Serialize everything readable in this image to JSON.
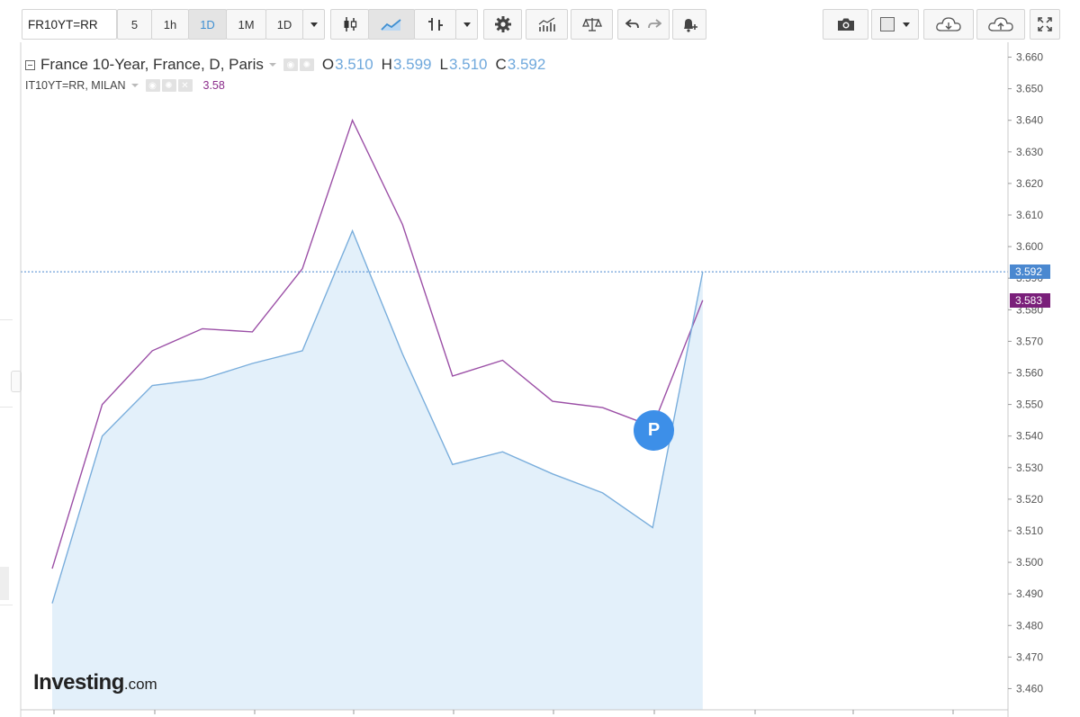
{
  "toolbar": {
    "symbol": "FR10YT=RR",
    "intervals": [
      "5",
      "1h",
      "1D",
      "1M",
      "1D"
    ],
    "active_interval_index": 2,
    "icons": [
      "candlestick-icon",
      "area-chart-icon",
      "bar-style-icon",
      "settings-gear-icon",
      "indicators-icon",
      "compare-scale-icon",
      "undo-icon",
      "redo-icon",
      "alert-bell-icon",
      "camera-icon",
      "color-swatch-icon",
      "cloud-download-icon",
      "cloud-upload-icon",
      "fullscreen-icon"
    ]
  },
  "legend": {
    "primary": {
      "name": "France 10-Year, France, D, Paris",
      "o_label": "O",
      "o_value": "3.510",
      "h_label": "H",
      "h_value": "3.599",
      "l_label": "L",
      "l_value": "3.510",
      "c_label": "C",
      "c_value": "3.592"
    },
    "secondary": {
      "name": "IT10YT=RR, MILAN",
      "value": "3.58"
    }
  },
  "price_tags": {
    "primary": "3.592",
    "secondary": "3.583"
  },
  "marker_label": "P",
  "watermark": {
    "brand": "Investing",
    "suffix": ".com"
  },
  "chart_data": {
    "type": "line",
    "ylim": [
      3.455,
      3.663
    ],
    "yticks": [
      "3.460",
      "3.470",
      "3.480",
      "3.490",
      "3.500",
      "3.510",
      "3.520",
      "3.530",
      "3.540",
      "3.550",
      "3.560",
      "3.570",
      "3.580",
      "3.590",
      "3.600",
      "3.610",
      "3.620",
      "3.630",
      "3.640",
      "3.650",
      "3.660"
    ],
    "current_line": 3.592,
    "series": [
      {
        "key": "fr",
        "name": "France 10-Year, France, D, Paris",
        "style": "area",
        "color": "#7aaedc",
        "fill": "#e3f0fa",
        "values": [
          3.487,
          3.54,
          3.556,
          3.558,
          3.563,
          3.567,
          3.605,
          3.566,
          3.531,
          3.535,
          3.528,
          3.522,
          3.511,
          3.592
        ]
      },
      {
        "key": "it",
        "name": "IT10YT=RR, MILAN",
        "style": "line",
        "color": "#9b4fa6",
        "values": [
          3.498,
          3.55,
          3.567,
          3.574,
          3.573,
          3.593,
          3.64,
          3.607,
          3.559,
          3.564,
          3.551,
          3.549,
          3.543,
          3.583
        ]
      }
    ]
  }
}
